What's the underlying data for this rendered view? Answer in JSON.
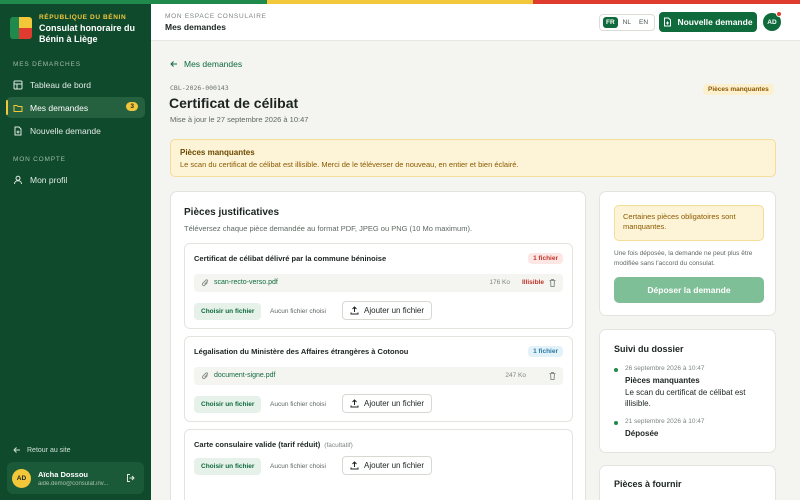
{
  "colors": {
    "brand_green": "#0f4a2d",
    "accent": "#0f6b3b",
    "flag_green": "#1f8a4c",
    "flag_yellow": "#f3c73a",
    "flag_red": "#e03b2f",
    "warning_bg": "#fdf3d6",
    "error": "#c0332b"
  },
  "sidebar": {
    "brand_sub": "RÉPUBLIQUE DU BÉNIN",
    "brand_title": "Consulat honoraire du Bénin à Liège",
    "section1": "MES DÉMARCHES",
    "items": [
      {
        "label": "Tableau de bord",
        "icon": "grid-icon"
      },
      {
        "label": "Mes demandes",
        "icon": "folder-icon",
        "badge": "3"
      },
      {
        "label": "Nouvelle demande",
        "icon": "file-plus-icon"
      }
    ],
    "section2": "MON COMPTE",
    "profile": "Mon profil",
    "back": "Retour au site",
    "user": {
      "initials": "AD",
      "name": "Aïcha Dossou",
      "email": "aide.demo@consulat.inv..."
    }
  },
  "header": {
    "subtitle": "MON ESPACE CONSULAIRE",
    "title": "Mes demandes",
    "langs": [
      "FR",
      "NL",
      "EN"
    ],
    "new_request": "Nouvelle demande",
    "avatar": "AD"
  },
  "request": {
    "back": "Mes demandes",
    "ref": "CBL-2026-000143",
    "title": "Certificat de célibat",
    "updated": "Mise à jour le 27 septembre 2026 à 10:47",
    "status": "Pièces manquantes"
  },
  "alert": {
    "title": "Pièces manquantes",
    "text": "Le scan du certificat de célibat est illisible. Merci de le téléverser de nouveau, en entier et bien éclairé."
  },
  "pieces": {
    "title": "Pièces justificatives",
    "subtitle": "Téléversez chaque pièce demandée au format PDF, JPEG ou PNG (10 Mo maximum).",
    "choose": "Choisir un fichier",
    "nofile": "Aucun fichier choisi",
    "add": "Ajouter un fichier",
    "items": [
      {
        "title": "Certificat de célibat délivré par la commune béninoise",
        "count": "1 fichier",
        "file": "scan-recto-verso.pdf",
        "size": "176 Ko",
        "file_status": "Illisible"
      },
      {
        "title": "Légalisation du Ministère des Affaires étrangères à Cotonou",
        "count": "1 fichier",
        "file": "document-signe.pdf",
        "size": "247 Ko"
      },
      {
        "title": "Carte consulaire valide (tarif réduit)",
        "optional": "(facultatif)"
      }
    ]
  },
  "submit": {
    "warning": "Certaines pièces obligatoires sont manquantes.",
    "note": "Une fois déposée, la demande ne peut plus être modifiée sans l'accord du consulat.",
    "button": "Déposer la demande"
  },
  "tracking": {
    "title": "Suivi du dossier",
    "events": [
      {
        "date": "26 septembre 2026 à 10:47",
        "title": "Pièces manquantes",
        "desc": "Le scan du certificat de célibat est illisible."
      },
      {
        "date": "21 septembre 2026 à 10:47",
        "title": "Déposée"
      }
    ]
  },
  "to_provide": {
    "title": "Pièces à fournir"
  }
}
